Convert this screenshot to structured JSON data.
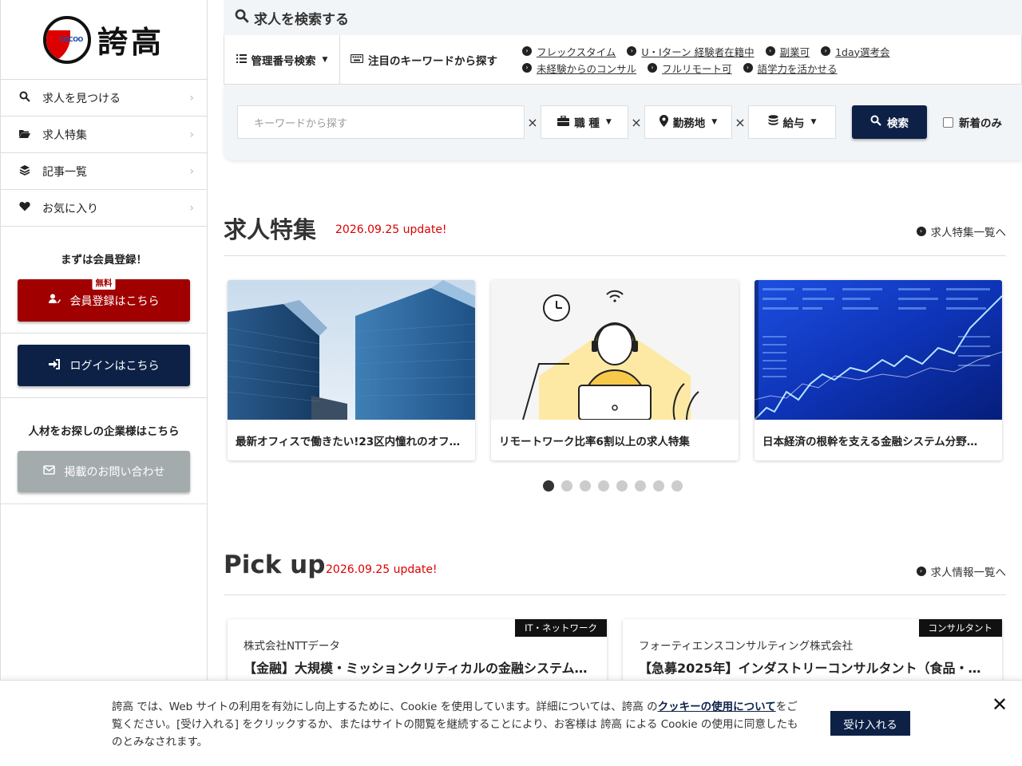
{
  "logo": {
    "mark_text": "COCOO",
    "kanji": "誇高"
  },
  "sidebar": {
    "items": [
      {
        "label": "求人を見つける"
      },
      {
        "label": "求人特集"
      },
      {
        "label": "記事一覧"
      },
      {
        "label": "お気に入り"
      }
    ],
    "register_title": "まずは会員登録！",
    "free_badge": "無料",
    "register_button": "会員登録はこちら",
    "login_button": "ログインはこちら",
    "corp_title": "人材をお探しの企業様はこちら",
    "contact_button": "掲載のお問い合わせ"
  },
  "search": {
    "heading": "求人を検索する",
    "mgmt_search": "管理番号検索",
    "focus_keywords": "注目のキーワードから探す",
    "keywords": [
      "フレックスタイム",
      "U・Iターン 経験者在籍中",
      "副業可",
      "1day選考会",
      "未経験からのコンサル",
      "フルリモート可",
      "語学力を活かせる"
    ],
    "input_placeholder": "キーワードから探す",
    "x_mark": "×",
    "job_type": "職 種",
    "location": "勤務地",
    "salary": "給与",
    "search_button": "検索",
    "new_only": "新着のみ"
  },
  "feature": {
    "title": "求人特集",
    "date": "2026.09.25 update!",
    "link": "求人特集一覧へ",
    "cards": [
      {
        "caption": "最新オフィスで働きたい!23区内憧れのオフ…"
      },
      {
        "caption": "リモートワーク比率6割以上の求人特集"
      },
      {
        "caption": "日本経済の根幹を支える金融システム分野…"
      }
    ]
  },
  "carousel": {
    "total_dots": 8,
    "active_index": 0
  },
  "pickup": {
    "title": "Pick up",
    "date": "2026.09.25 update!",
    "link": "求人情報一覧へ",
    "jobs": [
      {
        "tag": "IT・ネットワーク",
        "company": "株式会社NTTデータ",
        "title": "【金融】大規模・ミッションクリティカルの金融システム…"
      },
      {
        "tag": "コンサルタント",
        "company": "フォーティエンスコンサルティング株式会社",
        "title": "【急募2025年】インダストリーコンサルタント（食品・…"
      }
    ]
  },
  "cookie": {
    "text_before": "誇高 では、Web サイトの利用を有効にし向上するために、Cookie を使用しています。詳細については、誇高 の",
    "link": "クッキーの使用について",
    "text_after": "をご覧ください。[受け入れる] をクリックするか、またはサイトの閲覧を継続することにより、お客様は 誇高 による Cookie の使用に同意したものとみなされます。",
    "accept": "受け入れる",
    "close": "✕"
  },
  "colors": {
    "navy": "#0d2147",
    "red": "#a00000",
    "date_red": "#dd0000",
    "gray_button": "#a4abad",
    "panel_bg": "#f2f5f8"
  }
}
